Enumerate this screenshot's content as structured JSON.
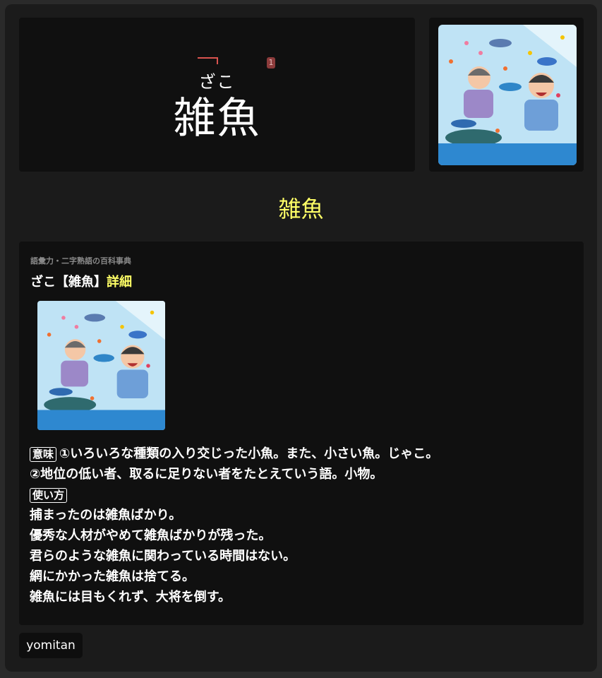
{
  "word": {
    "reading": "ざこ",
    "expression": "雑魚",
    "pitch_number": "1"
  },
  "display_word": "雑魚",
  "definition": {
    "dictionary": "語彙力・二字熟語の百科事典",
    "headword": "ざこ【雑魚】",
    "detail_link": "詳細",
    "meaning_tag": "意味",
    "meaning_lines": [
      "①いろいろな種類の入り交じった小魚。また、小さい魚。じゃこ。",
      "②地位の低い者、取るに足りない者をたとえていう語。小物。"
    ],
    "usage_tag": "使い方",
    "examples": [
      "捕まったのは雑魚ばかり。",
      "優秀な人材がやめて雑魚ばかりが残った。",
      "君らのような雑魚に関わっている時間はない。",
      "網にかかった雑魚は捨てる。",
      "雑魚には目もくれず、大将を倒す。"
    ]
  },
  "footer": {
    "button_label": "yomitan"
  },
  "image_subject": "aquarium-illustration",
  "colors": {
    "accent_yellow": "#ffff66",
    "pitch_red": "#d9534f",
    "panel": "#101010",
    "card": "#1b1b1b"
  }
}
